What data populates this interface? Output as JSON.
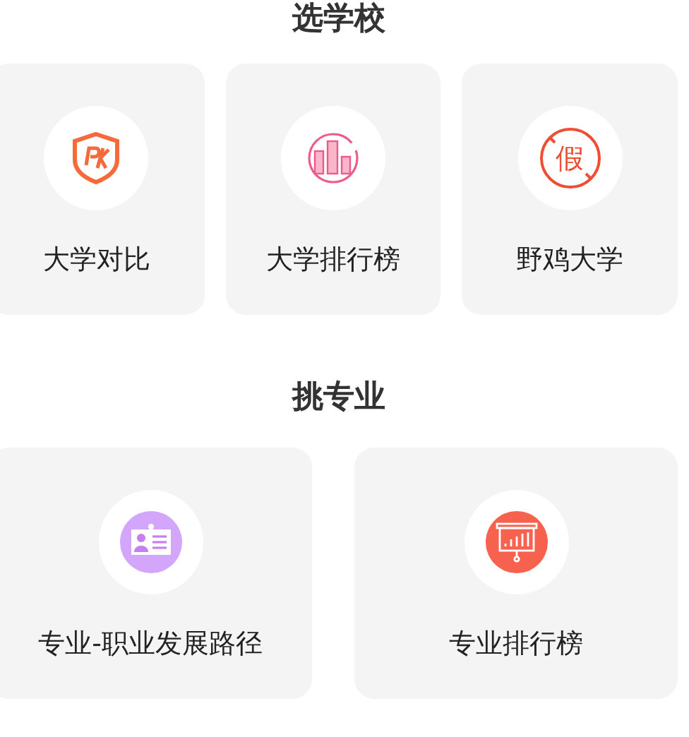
{
  "sections": [
    {
      "title": "选学校",
      "items": [
        {
          "label": "大学对比",
          "kind": "shield"
        },
        {
          "label": "大学排行榜",
          "kind": "bars"
        },
        {
          "label": "野鸡大学",
          "kind": "prohibited",
          "icon_text": "假"
        }
      ]
    },
    {
      "title": "挑专业",
      "items": [
        {
          "label": "专业-职业发展路径",
          "kind": "card"
        },
        {
          "label": "专业排行榜",
          "kind": "board"
        }
      ]
    }
  ]
}
